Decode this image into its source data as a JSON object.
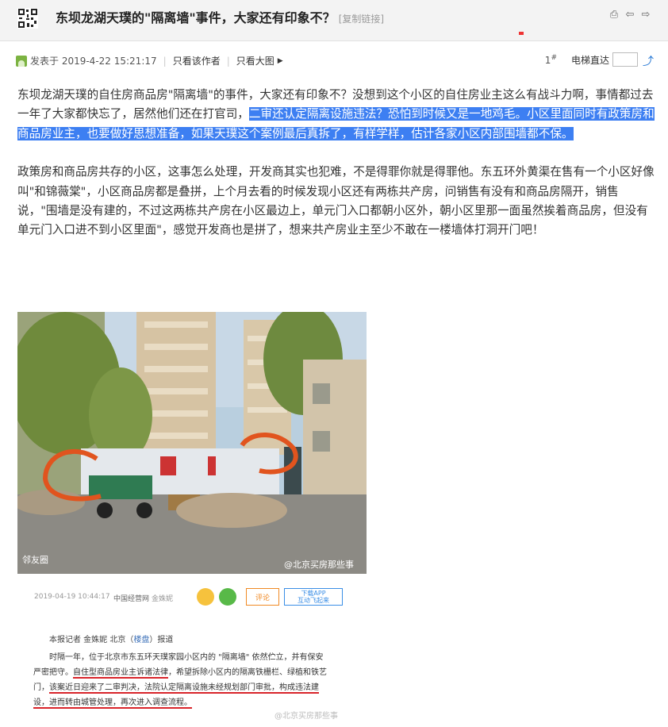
{
  "header": {
    "title": "东坝龙湖天璞的\"隔离墙\"事件，大家还有印象不？",
    "copy_link": "[复制链接]"
  },
  "postbar": {
    "posted_at": "发表于 2019-4-22 15:21:17",
    "only_author": "只看该作者",
    "only_images": "只看大图",
    "floor_number": "1",
    "floor_mark": "#",
    "elevator_label": "电梯直达"
  },
  "content": {
    "p1_plain": "东坝龙湖天璞的自住房商品房\"隔离墙\"的事件，大家还有印象不？没想到这个小区的自住房业主这么有战斗力啊，事情都过去一年了大家都快忘了，居然他们还在打官司，",
    "p1_highlight": "二审还认定隔离设施违法？恐怕到时候又是一地鸡毛。小区里面同时有政策房和商品房业主，也要做好思想准备，如果天璞这个案例最后真拆了，有样学样，估计各家小区内部围墙都不保。",
    "p2": "政策房和商品房共存的小区，这事怎么处理，开发商其实也犯难，不是得罪你就是得罪他。东五环外黄渠在售有一个小区好像叫\"和锦薇棠\"，小区商品房都是叠拼，上个月去看的时候发现小区还有两栋共产房，问销售有没有和商品房隔开，销售说，\"围墙是没有建的，不过这两栋共产房在小区最边上，单元门入口都朝小区外，朝小区里那一面虽然挨着商品房，但没有单元门入口进不到小区里面\"，感觉开发商也是拼了，想来共产房业主至少不敢在一楼墙体打洞开门吧！"
  },
  "photo": {
    "corner_label": "邻友圈",
    "watermark": "@北京买房那些事"
  },
  "clipping": {
    "date": "2019-04-19 10:44:17",
    "source": "中国经营网",
    "author": "金姝妮",
    "comment_label": "评论",
    "app_line1": "下载APP",
    "app_line2": "互动飞起来",
    "byline_pre": "本报记者 金姝妮 北京（",
    "byline_link": "楼盘",
    "byline_post": "）报道",
    "line1": "时隔一年，位于北京市东五环天璞家园小区内的 \"隔离墙\" 依然伫立，并有保安",
    "line2_a": "严密把守。",
    "line2_b": "自住型商品房业主诉诸法律",
    "line2_c": "，希望拆除小区内的隔离铁栅栏、绿植和铁艺",
    "line3_a": "门，",
    "line3_b": "该案近日迎来了二审判决，法院认定隔离设施未经规划部门审批，构成违法建",
    "line4": "设，进而转由城管处理，再次进入调查流程。",
    "watermark": "@北京买房那些事"
  },
  "colors": {
    "highlight": "#3d7ff2",
    "underline_red": "#d8242a"
  }
}
